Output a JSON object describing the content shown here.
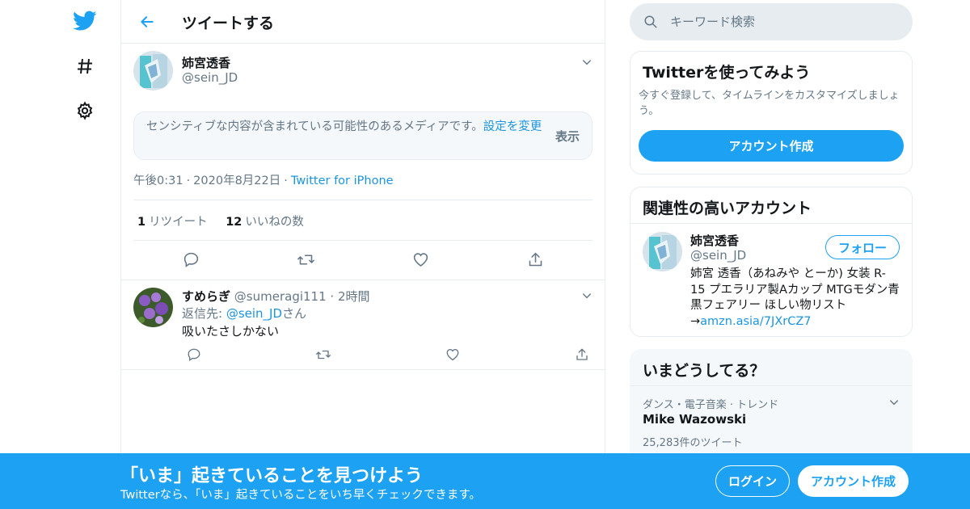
{
  "header": {
    "title": "ツイートする"
  },
  "tweet": {
    "author_name": "姉宮透香",
    "author_handle": "@sein_JD",
    "sensitive_text": "センシティブな内容が含まれている可能性のあるメディアです。",
    "sensitive_link": "設定を変更",
    "show_label": "表示",
    "time": "午後0:31",
    "date": "2020年8月22日",
    "source": "Twitter for iPhone",
    "retweet_count": "1",
    "retweet_label": "リツイート",
    "like_count": "12",
    "like_label": "いいねの数"
  },
  "reply": {
    "author_name": "すめらぎ",
    "author_handle": "@sumeragi111",
    "time": "2時間",
    "reply_to_prefix": "返信先: ",
    "reply_to_handle": "@sein_JD",
    "reply_to_suffix": "さん",
    "text": "吸いたさしかない"
  },
  "search": {
    "placeholder": "キーワード検索"
  },
  "signup_card": {
    "title": "Twitterを使ってみよう",
    "description": "今すぐ登録して、タイムラインをカスタマイズしましょう。",
    "button": "アカウント作成"
  },
  "related_card": {
    "title": "関連性の高いアカウント",
    "name": "姉宮透香",
    "handle": "@sein_JD",
    "follow_button": "フォロー",
    "bio": "姉宮 透香（あねみや とーか) 女装 R-15 プエラリア製Aカップ MTGモダン青黒フェアリー ほしい物リスト→",
    "bio_link": "amzn.asia/7JXrCZ7"
  },
  "trends_card": {
    "title": "いまどうしてる？",
    "trend_context": "ダンス・電子音楽 · トレンド",
    "trend_name": "Mike Wazowski",
    "trend_count": "25,283件のツイート"
  },
  "banner": {
    "title": "「いま」起きていることを見つけよう",
    "subtitle": "Twitterなら、「いま」起きていることをいち早くチェックできます。",
    "login": "ログイン",
    "signup": "アカウント作成"
  },
  "colors": {
    "brand": "#1da1f2",
    "link": "#1b95e0",
    "secondary_text": "#657786",
    "border": "#e6ecf0"
  },
  "icons": [
    "twitter-bird-icon",
    "hashtag-icon",
    "gear-icon",
    "back-arrow-icon",
    "chevron-down-icon",
    "reply-icon",
    "retweet-icon",
    "like-icon",
    "share-icon",
    "search-icon"
  ]
}
